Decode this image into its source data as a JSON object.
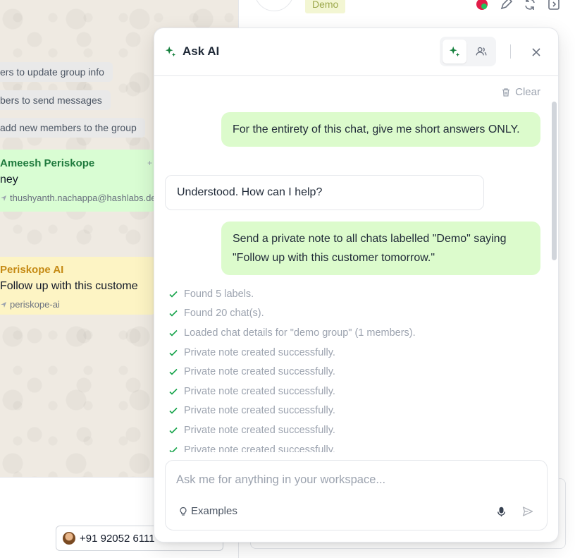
{
  "background": {
    "system_messages": [
      "ers to update group info",
      "bers to send messages",
      "add new members to the group"
    ],
    "green_bubble": {
      "sender": "Ameesh Periskope",
      "text": "ney",
      "meta": "thushyanth.nachappa@hashlabs.de",
      "plus": "+"
    },
    "yellow_bubble": {
      "sender": "Periskope AI",
      "text": "Follow up with this custome",
      "meta": "periskope-ai"
    },
    "phone_label": "+91 92052 6111",
    "tag_label": "Demo",
    "top_icons": [
      "profile-dots-icon",
      "edit-icon",
      "refresh-icon",
      "sidebar-toggle-icon"
    ]
  },
  "panel": {
    "title": "Ask AI",
    "clear_label": "Clear",
    "icons": {
      "title": "sparkle-icon",
      "mode_ai": "sparkle-icon",
      "mode_people": "people-icon",
      "close": "close-icon",
      "clear": "trash-icon",
      "examples": "lightbulb-icon",
      "mic": "mic-icon",
      "send": "send-icon"
    },
    "colors": {
      "accent": "#16a34a",
      "user_bubble": "#dcfbcc"
    },
    "messages": [
      {
        "role": "user",
        "text": "For the entirety of this chat, give me short answers ONLY."
      },
      {
        "role": "assistant",
        "text": "Understood. How can I help?"
      },
      {
        "role": "user",
        "text": "Send a private note to all chats labelled \"Demo\" saying \"Follow up with this customer tomorrow.\""
      }
    ],
    "status_items": [
      "Found 5 labels.",
      "Found 20 chat(s).",
      "Loaded chat details for \"demo group\" (1 members).",
      "Private note created successfully.",
      "Private note created successfully.",
      "Private note created successfully.",
      "Private note created successfully.",
      "Private note created successfully.",
      "Private note created successfully."
    ],
    "input": {
      "value": "",
      "placeholder": "Ask me for anything in your workspace..."
    },
    "examples_label": "Examples"
  }
}
